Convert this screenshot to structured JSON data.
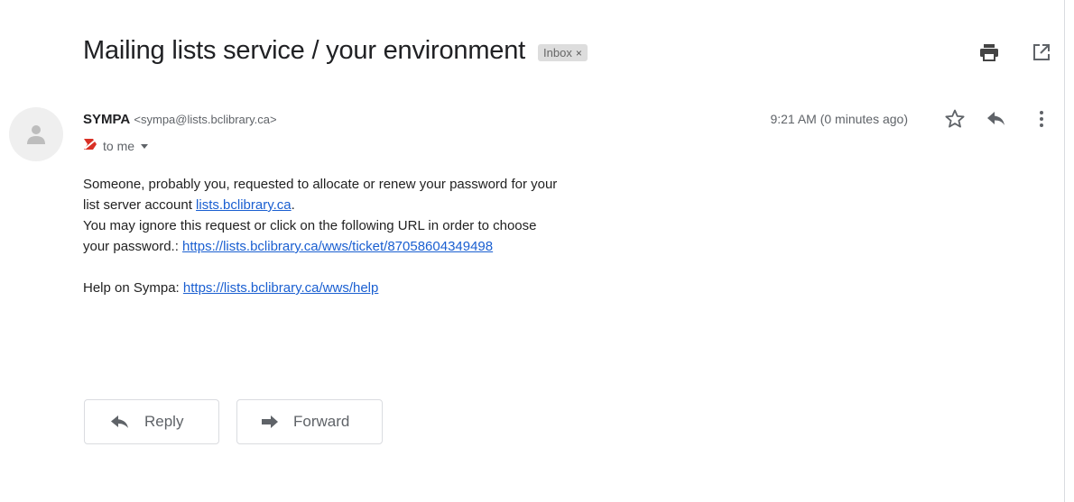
{
  "email": {
    "subject": "Mailing lists service / your environment",
    "label": "Inbox",
    "label_close": "×",
    "sender_name": "SYMPA",
    "sender_email": "<sympa@lists.bclibrary.ca>",
    "recipient": "to me",
    "timestamp": "9:21 AM (0 minutes ago)",
    "body": {
      "line1": "Someone, probably you, requested to allocate or renew your password for your",
      "line2_prefix": "list server account ",
      "account_link": "lists.bclibrary.ca",
      "line2_suffix": ".",
      "line3": "You may ignore this request or click on the following URL in order to choose",
      "line4_prefix": "your password.: ",
      "ticket_link": "https://lists.bclibrary.ca/wws/ticket/87058604349498",
      "help_prefix": "Help on Sympa: ",
      "help_link": "https://lists.bclibrary.ca/wws/help"
    }
  },
  "actions": {
    "reply_label": "Reply",
    "forward_label": "Forward"
  },
  "icons": {
    "print": "print-icon",
    "open_new_window": "open-in-new-icon",
    "star": "star-icon",
    "reply": "reply-icon",
    "more": "more-vert-icon",
    "avatar": "person-icon",
    "importance": "not-important-marker-icon",
    "dropdown": "caret-down-icon",
    "forward": "forward-icon"
  },
  "colors": {
    "link": "#1a5fd1",
    "label_bg": "#dddddd",
    "marker": "#d93025"
  }
}
